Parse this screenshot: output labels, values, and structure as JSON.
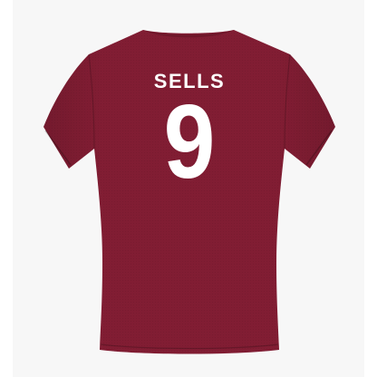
{
  "product": {
    "player_name": "SELLS",
    "player_number": "9",
    "shirt_color": "#811d33",
    "print_color": "#ffffff",
    "background_color": "#f7f7f7"
  }
}
